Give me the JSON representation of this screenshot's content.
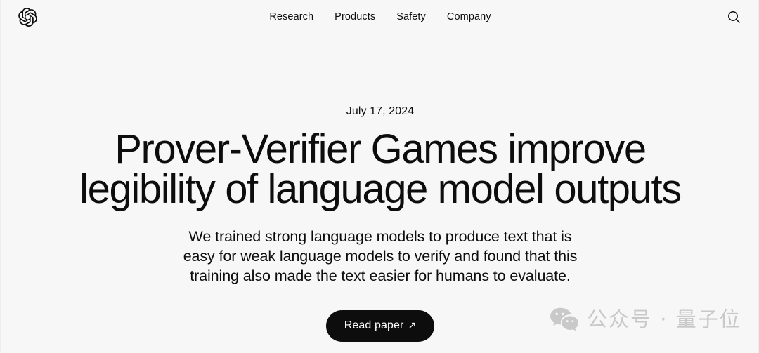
{
  "page": {
    "background_color": "#f7f7f7",
    "text_color": "#0d0d0d"
  },
  "header": {
    "logo_name": "openai-logo",
    "nav_items": [
      {
        "label": "Research"
      },
      {
        "label": "Products"
      },
      {
        "label": "Safety"
      },
      {
        "label": "Company"
      }
    ],
    "search_icon": "search-icon"
  },
  "hero": {
    "date": "July 17, 2024",
    "headline_lines": [
      "Prover-Verifier Games improve",
      "legibility of language model outputs"
    ],
    "subtitle_lines": [
      "We trained strong language models to produce text that is",
      "easy for weak language models to verify and found that this",
      "training also made the text easier for humans to evaluate."
    ],
    "cta": {
      "label": "Read paper",
      "icon": "arrow-up-right-icon",
      "icon_glyph": "↗",
      "background_color": "#0d0d0d",
      "text_color": "#ffffff"
    }
  },
  "watermark": {
    "icon": "wechat-icon",
    "text": "公众号 · 量子位",
    "color": "#c9c9c9"
  }
}
